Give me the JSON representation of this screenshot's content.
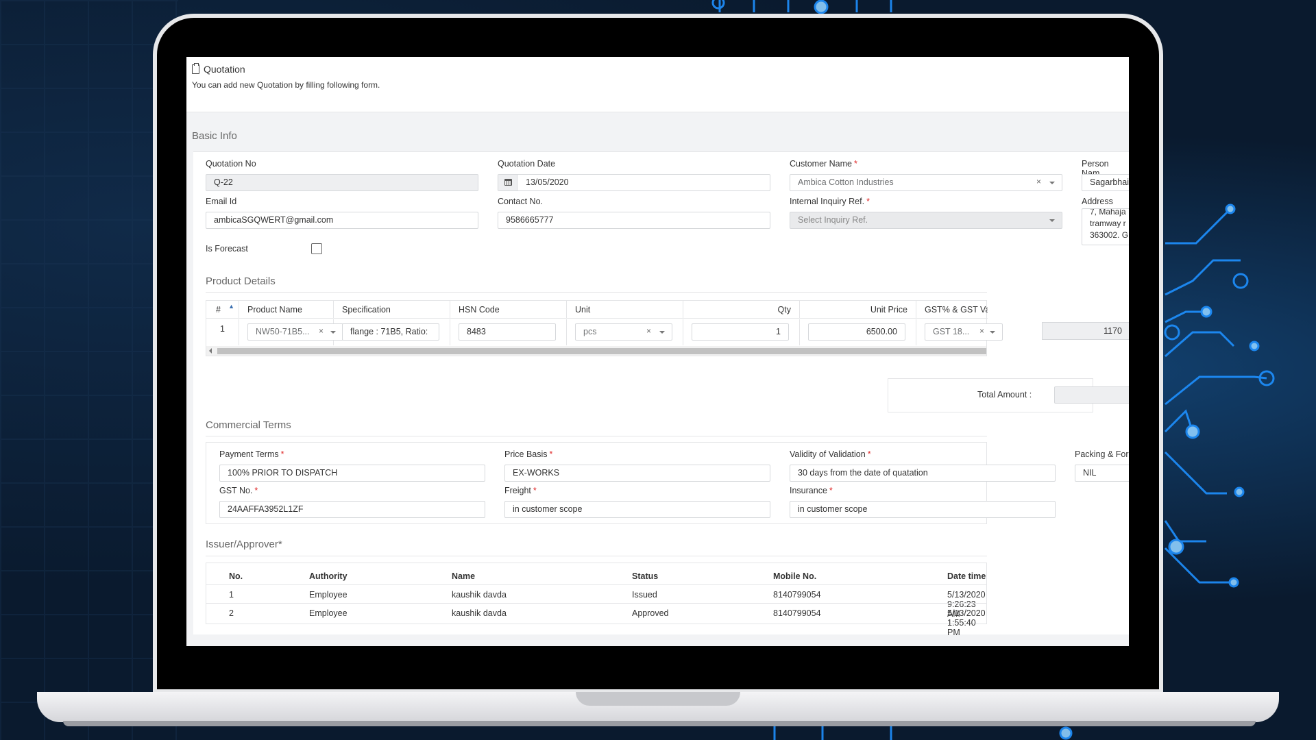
{
  "header": {
    "title": "Quotation",
    "subtitle": "You can add new Quotation by filling following form."
  },
  "basic_info": {
    "section_title": "Basic Info",
    "quotation_no": {
      "label": "Quotation No",
      "value": "Q-22"
    },
    "quotation_date": {
      "label": "Quotation Date",
      "value": "13/05/2020"
    },
    "customer_name": {
      "label": "Customer Name",
      "required": "*",
      "value": "Ambica Cotton Industries"
    },
    "person_name": {
      "label": "Person Nam",
      "value": "Sagarbhai"
    },
    "email": {
      "label": "Email Id",
      "value": "ambicaSGQWERT@gmail.com"
    },
    "contact": {
      "label": "Contact No.",
      "value": "9586665777"
    },
    "inquiry_ref": {
      "label": "Internal Inquiry Ref.",
      "required": "*",
      "placeholder": "Select Inquiry Ref."
    },
    "address": {
      "label": "Address",
      "lines": [
        "7, Mahaja",
        "tramway r",
        "363002. G"
      ]
    },
    "is_forecast": {
      "label": "Is Forecast"
    }
  },
  "product_details": {
    "title": "Product Details",
    "columns": [
      "#",
      "Product Name",
      "Specification",
      "HSN Code",
      "Unit",
      "Qty",
      "Unit Price",
      "GST% & GST Value"
    ],
    "row": {
      "index": "1",
      "product": "NW50-71B5...",
      "specification": "flange : 71B5, Ratio:",
      "hsn": "8483",
      "unit": "pcs",
      "qty": "1",
      "unit_price": "6500.00",
      "gst": "GST 18...",
      "gst_value": "1170"
    },
    "total_label": "Total Amount :"
  },
  "commercial_terms": {
    "title": "Commercial Terms",
    "payment_terms": {
      "label": "Payment Terms",
      "required": "*",
      "value": "100% PRIOR TO DISPATCH"
    },
    "price_basis": {
      "label": "Price Basis",
      "required": "*",
      "value": "EX-WORKS"
    },
    "validity": {
      "label": "Validity of Validation",
      "required": "*",
      "value": "30 days from the date of quatation"
    },
    "packing": {
      "label": "Packing & For",
      "value": "NIL"
    },
    "gst_no": {
      "label": "GST No.",
      "required": "*",
      "value": "24AAFFA3952L1ZF"
    },
    "freight": {
      "label": "Freight",
      "required": "*",
      "value": "in customer scope"
    },
    "insurance": {
      "label": "Insurance",
      "required": "*",
      "value": "in customer scope"
    }
  },
  "issuer": {
    "title": "Issuer/Approver*",
    "columns": [
      "No.",
      "Authority",
      "Name",
      "Status",
      "Mobile No.",
      "Date time"
    ],
    "rows": [
      [
        "1",
        "Employee",
        "kaushik davda",
        "Issued",
        "8140799054",
        "5/13/2020 9:26:23 AM"
      ],
      [
        "2",
        "Employee",
        "kaushik davda",
        "Approved",
        "8140799054",
        "5/13/2020 1:55:40 PM"
      ]
    ]
  },
  "colors": {
    "accent": "#1e90ff",
    "required": "#e02a2a",
    "background": "#0a1a2e"
  }
}
